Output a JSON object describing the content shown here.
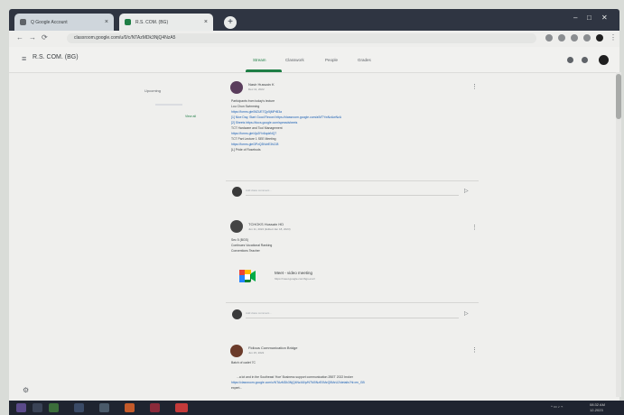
{
  "browser": {
    "tabs": [
      {
        "label": "Q Google Account"
      },
      {
        "label": "R.S. COM. (BG)"
      }
    ],
    "new_tab": "+",
    "url": "classroom.google.com/u/0/c/NTAzMDk3NjQ4NzA5"
  },
  "app": {
    "class_name": "R.S. COM. (BG)",
    "nav_tabs": [
      "Stream",
      "Classwork",
      "People",
      "Grades"
    ],
    "active_tab": "Stream"
  },
  "sidebar": {
    "upcoming_title": "Upcoming",
    "view_all": "View all"
  },
  "posts": [
    {
      "author": "Nasir Hussain K",
      "date": "Dec 11, 2022",
      "lines": [
        "Participants from today's lecture",
        "Lou Chun Swimming",
        "https://forms.gle/5tZUE7Qp5jMPrB3a",
        "[1] Nice Day, Start Good Record  https://classroom.google.com/a/MTYwNzAwNzA",
        "[2] Sheets  https://docs.google.com/spreadsheets",
        "TCT Hardware and Tool Management",
        "https://forms.gle/4jc2lYv6qdzNQ7",
        "TCT Part Lecture 1 SEE  Meeting",
        "https://forms.gle/3PzQ3NdrE3h2J8",
        "[L] Pride of Rosebuds"
      ],
      "comment_placeholder": "Add class comment..."
    },
    {
      "author": "TCHOKS Hussain HD",
      "date": "Jun 11, 2022  (Edited Jan 18, 2023)",
      "lines": [
        "Sec 5 (BGS)",
        "Continues Vocational   Ranking",
        "Conventions Teacher"
      ],
      "attachment": {
        "title": "Meet - video meeting",
        "url": "https://meet.google.com/bgs-exvz"
      },
      "comment_placeholder": "Add class comment..."
    },
    {
      "author": "Fidious Communication Bridge",
      "date": "Jun 15, 2022",
      "lines": [
        "Batch of cadet 7C",
        "",
        "...a lot and in the Southeast 'Hoe'  Business support communication 2BET 2022  broker",
        "https://classroom.google.com/c/NTAzMDk3NjQ4NzA5/p/NTM0NzE0MzQ5MzU2/details?hl=en_GB",
        "expert..."
      ]
    }
  ],
  "taskbar": {
    "clock": "08:32 AM",
    "date": "12-2023"
  }
}
